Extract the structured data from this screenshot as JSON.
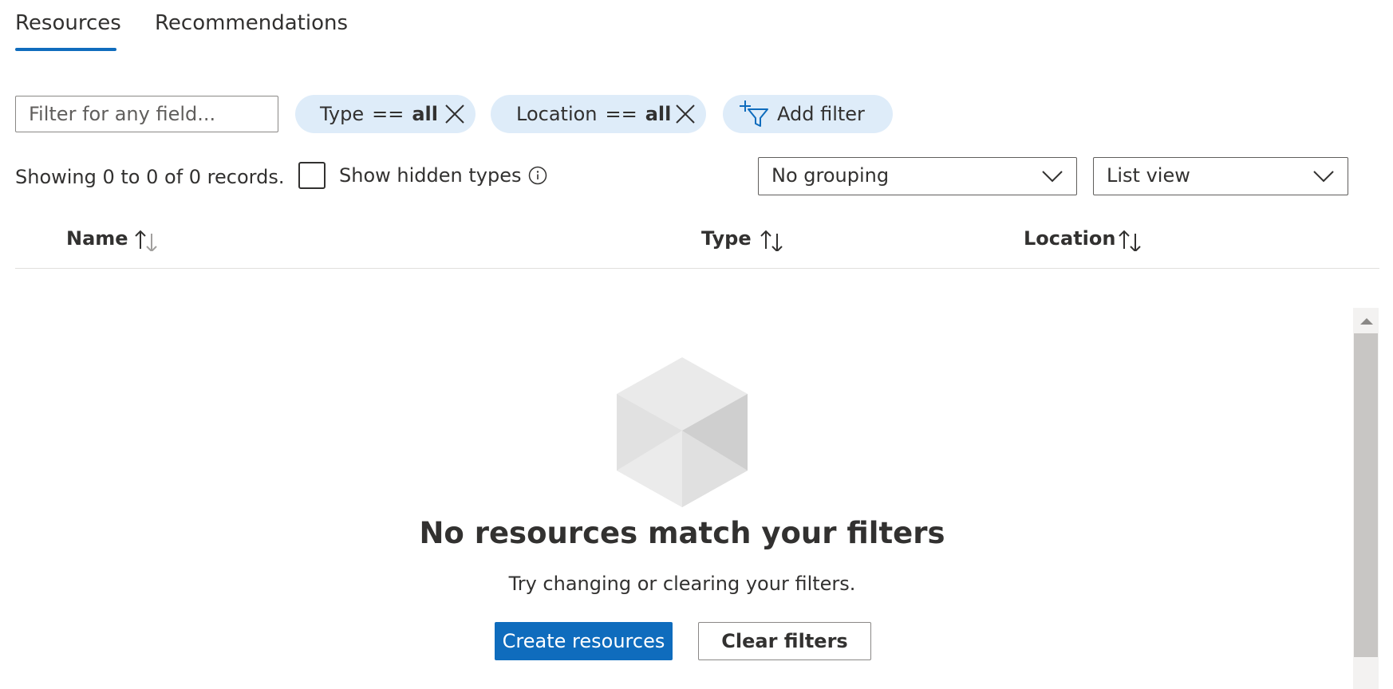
{
  "tabs": [
    {
      "label": "Resources",
      "active": true
    },
    {
      "label": "Recommendations",
      "active": false
    }
  ],
  "filters": {
    "search_placeholder": "Filter for any field...",
    "pills": [
      {
        "field": "Type",
        "operator": "==",
        "value": "all"
      },
      {
        "field": "Location",
        "operator": "==",
        "value": "all"
      }
    ],
    "add_filter_label": "Add filter"
  },
  "toolbar": {
    "records_text": "Showing 0 to 0 of 0 records.",
    "show_hidden_label": "Show hidden types",
    "show_hidden_checked": false,
    "grouping_value": "No grouping",
    "view_value": "List view"
  },
  "table": {
    "columns": [
      "Name",
      "Type",
      "Location"
    ]
  },
  "empty_state": {
    "title": "No resources match your filters",
    "subtitle": "Try changing or clearing your filters.",
    "primary_button": "Create resources",
    "secondary_button": "Clear filters"
  },
  "colors": {
    "accent": "#0f6cbd",
    "pill_bg": "#deecf9",
    "text": "#323130"
  }
}
